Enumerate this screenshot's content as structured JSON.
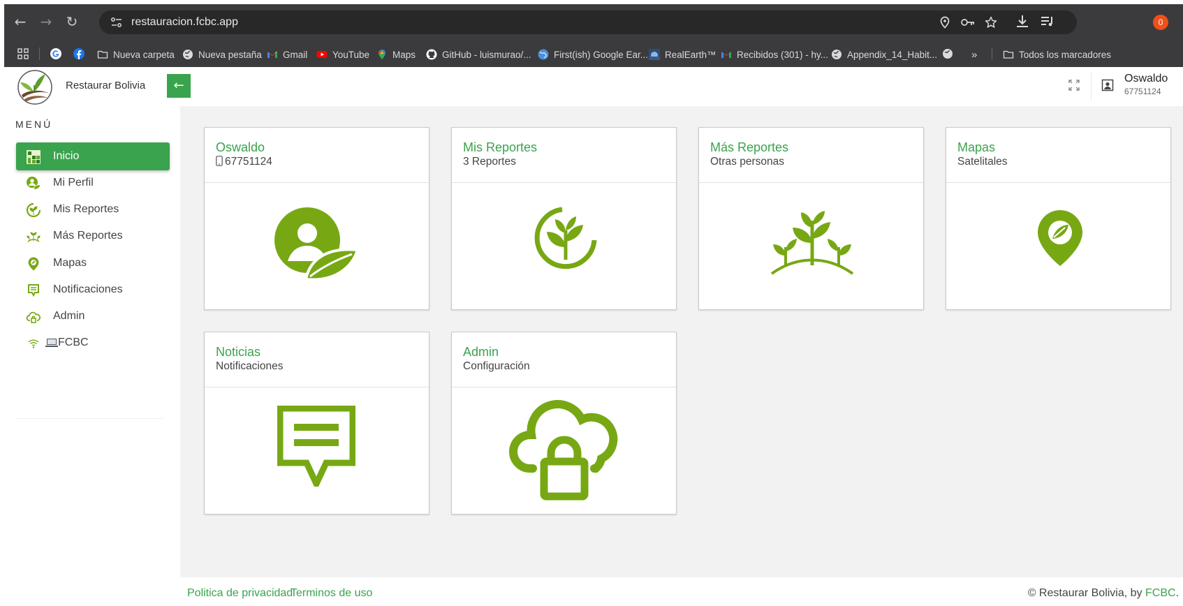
{
  "browser": {
    "url": "restauracion.fcbc.app",
    "profile_badge": "0",
    "bookmarks": [
      {
        "label": "Nueva carpeta",
        "icon": "folder-icon"
      },
      {
        "label": "Nueva pestaña",
        "icon": "globe-icon"
      },
      {
        "label": "Gmail",
        "icon": "gmail-icon"
      },
      {
        "label": "YouTube",
        "icon": "youtube-icon"
      },
      {
        "label": "Maps",
        "icon": "maps-icon"
      },
      {
        "label": "GitHub - luismurao/...",
        "icon": "github-icon"
      },
      {
        "label": "First(ish) Google Ear...",
        "icon": "earth-icon"
      },
      {
        "label": "RealEarth™",
        "icon": "realearth-icon"
      },
      {
        "label": "Recibidos (301) - hy...",
        "icon": "gmail-icon"
      },
      {
        "label": "Appendix_14_Habit...",
        "icon": "globe-icon"
      },
      {
        "label": "Todos los marcadores",
        "icon": "folder-icon"
      }
    ],
    "overflow_label": "»"
  },
  "header": {
    "brand": "Restaurar Bolivia",
    "user_name": "Oswaldo",
    "user_phone": "67751124"
  },
  "sidebar": {
    "title": "MENÚ",
    "items": [
      {
        "label": "Inicio",
        "icon": "home-grid-icon",
        "active": true
      },
      {
        "label": "Mi Perfil",
        "icon": "user-leaf-icon"
      },
      {
        "label": "Mis Reportes",
        "icon": "plant-circle-icon"
      },
      {
        "label": "Más Reportes",
        "icon": "plants-icon"
      },
      {
        "label": "Mapas",
        "icon": "map-pin-leaf-icon"
      },
      {
        "label": "Notificaciones",
        "icon": "message-icon"
      },
      {
        "label": "Admin",
        "icon": "cloud-lock-icon"
      },
      {
        "label": "FCBC",
        "icon": "wifi-laptop-icon"
      }
    ]
  },
  "cards": [
    {
      "title": "Oswaldo",
      "subtitle": "67751124",
      "icon": "user-leaf-icon"
    },
    {
      "title": "Mis Reportes",
      "subtitle": "3 Reportes",
      "icon": "plant-circle-icon"
    },
    {
      "title": "Más Reportes",
      "subtitle": "Otras personas",
      "icon": "plants-icon"
    },
    {
      "title": "Mapas",
      "subtitle": "Satelitales",
      "icon": "map-pin-leaf-icon"
    },
    {
      "title": "Noticias",
      "subtitle": "Notificaciones",
      "icon": "message-icon"
    },
    {
      "title": "Admin",
      "subtitle": "Configuración",
      "icon": "cloud-lock-icon"
    }
  ],
  "footer": {
    "privacy": "Politica de privacidad",
    "terms": "Terminos de uso",
    "copyright_prefix": "© Restaurar Bolivia, by ",
    "copyright_link": "FCBC",
    "copyright_suffix": "."
  },
  "colors": {
    "accent": "#3aa34d",
    "icon_green": "#77a814",
    "chrome_dark": "#3b3b3d",
    "content_bg": "#f2f2f2"
  }
}
